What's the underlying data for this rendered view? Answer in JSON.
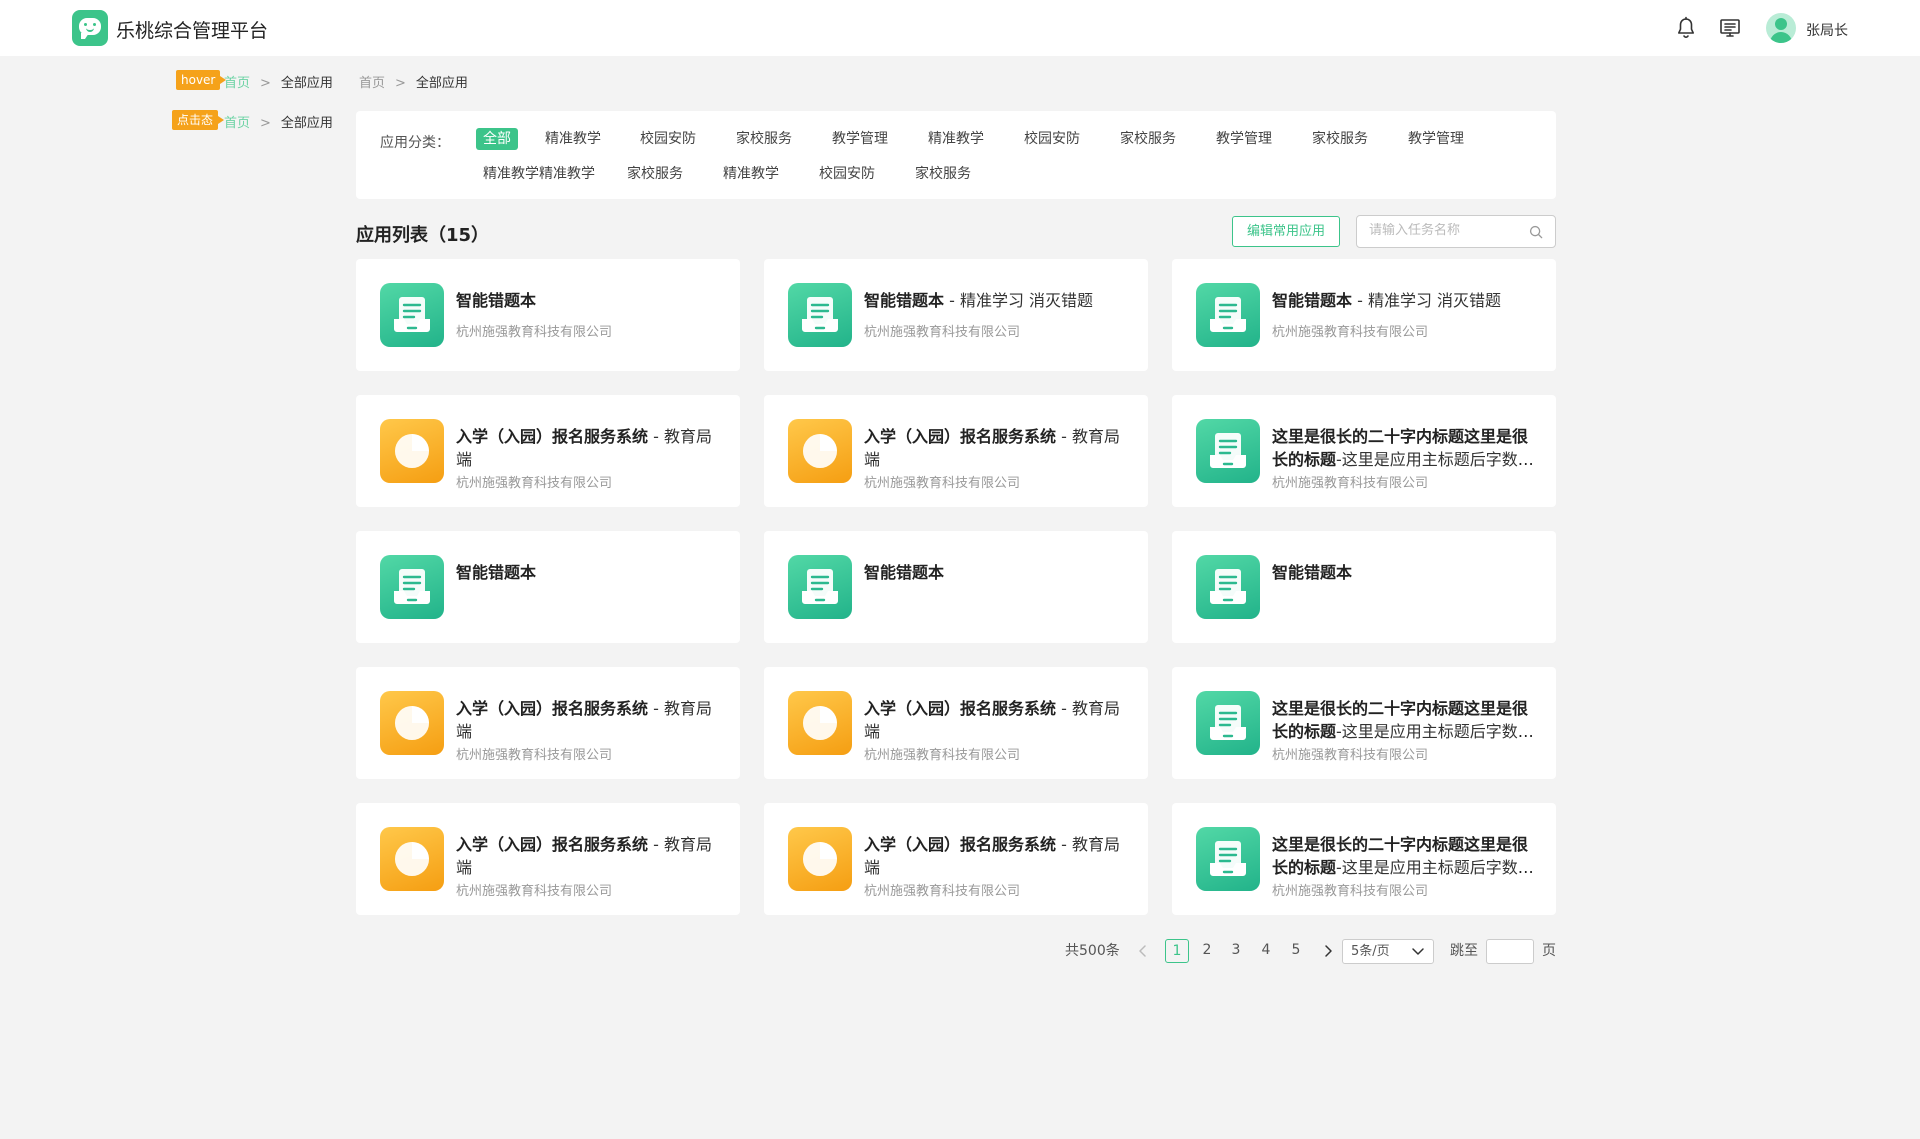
{
  "header": {
    "app_title": "乐桃综合管理平台",
    "username": "张局长"
  },
  "breadcrumb_demos": [
    {
      "tag": "hover",
      "home": "首页",
      "sep": ">",
      "current": "全部应用"
    },
    {
      "tag": "点击态",
      "home": "首页",
      "sep": ">",
      "current": "全部应用"
    }
  ],
  "breadcrumb": {
    "home": "首页",
    "sep": ">",
    "current": "全部应用"
  },
  "categories": {
    "label": "应用分类：",
    "items": [
      "全部",
      "精准教学",
      "校园安防",
      "家校服务",
      "教学管理",
      "精准教学",
      "校园安防",
      "家校服务",
      "教学管理",
      "家校服务",
      "教学管理",
      "精准教学精准教学",
      "家校服务",
      "精准教学",
      "校园安防",
      "家校服务"
    ],
    "active_index": 0
  },
  "list": {
    "title": "应用列表（15）",
    "edit_button": "编辑常用应用",
    "search_placeholder": "请输入任务名称"
  },
  "apps": [
    {
      "title": "智能错题本",
      "subtitle": "",
      "company": "杭州施强教育科技有限公司",
      "icon": "tray-icon",
      "color": "green"
    },
    {
      "title": "智能错题本",
      "subtitle": " - 精准学习 消灭错题",
      "company": "杭州施强教育科技有限公司",
      "icon": "tray-icon",
      "color": "green"
    },
    {
      "title": "智能错题本",
      "subtitle": " - 精准学习 消灭错题",
      "company": "杭州施强教育科技有限公司",
      "icon": "tray-icon",
      "color": "green"
    },
    {
      "title": "入学（入园）报名服务系统",
      "subtitle": " - 教育局端",
      "company": "杭州施强教育科技有限公司",
      "icon": "pie-icon",
      "color": "orange"
    },
    {
      "title": "入学（入园）报名服务系统",
      "subtitle": " - 教育局端",
      "company": "杭州施强教育科技有限公司",
      "icon": "pie-icon",
      "color": "orange"
    },
    {
      "title": "这里是很长的二十字内标题这里是很长的标题",
      "subtitle": "-这里是应用主标题后字数很多的情况",
      "company": "杭州施强教育科技有限公司",
      "icon": "tray-icon",
      "color": "green"
    },
    {
      "title": "智能错题本",
      "subtitle": "",
      "company": "",
      "icon": "tray-icon",
      "color": "green"
    },
    {
      "title": "智能错题本",
      "subtitle": "",
      "company": "",
      "icon": "tray-icon",
      "color": "green"
    },
    {
      "title": "智能错题本",
      "subtitle": "",
      "company": "",
      "icon": "tray-icon",
      "color": "green"
    },
    {
      "title": "入学（入园）报名服务系统",
      "subtitle": " - 教育局端",
      "company": "杭州施强教育科技有限公司",
      "icon": "pie-icon",
      "color": "orange"
    },
    {
      "title": "入学（入园）报名服务系统",
      "subtitle": " - 教育局端",
      "company": "杭州施强教育科技有限公司",
      "icon": "pie-icon",
      "color": "orange"
    },
    {
      "title": "这里是很长的二十字内标题这里是很长的标题",
      "subtitle": "-这里是应用主标题后字数很多的情况",
      "company": "杭州施强教育科技有限公司",
      "icon": "tray-icon",
      "color": "green"
    },
    {
      "title": "入学（入园）报名服务系统",
      "subtitle": " - 教育局端",
      "company": "杭州施强教育科技有限公司",
      "icon": "pie-icon",
      "color": "orange"
    },
    {
      "title": "入学（入园）报名服务系统",
      "subtitle": " - 教育局端",
      "company": "杭州施强教育科技有限公司",
      "icon": "pie-icon",
      "color": "orange"
    },
    {
      "title": "这里是很长的二十字内标题这里是很长的标题",
      "subtitle": "-这里是应用主标题后字数很多的情况",
      "company": "杭州施强教育科技有限公司",
      "icon": "tray-icon",
      "color": "green"
    }
  ],
  "pagination": {
    "total": "共500条",
    "pages": [
      "1",
      "2",
      "3",
      "4",
      "5"
    ],
    "current_page": "1",
    "page_size": "5条/页",
    "jump_label": "跳至",
    "page_unit": "页"
  },
  "colors": {
    "accent": "#3cc48a",
    "tag": "#f5a21a",
    "icon_green": "#2fc195",
    "icon_orange": "#f7a51b"
  }
}
